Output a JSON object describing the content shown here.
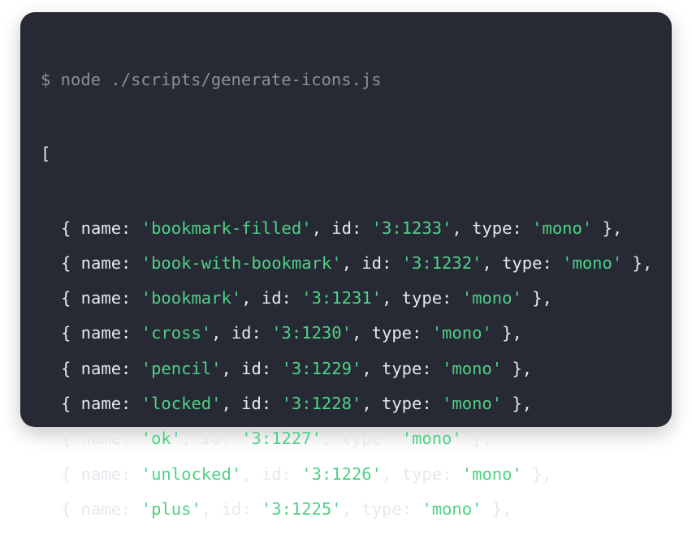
{
  "terminal": {
    "command": "$ node ./scripts/generate-icons.js",
    "open_bracket": "[",
    "entries": [
      {
        "name": "bookmark-filled",
        "id": "3:1233",
        "type": "mono"
      },
      {
        "name": "book-with-bookmark",
        "id": "3:1232",
        "type": "mono"
      },
      {
        "name": "bookmark",
        "id": "3:1231",
        "type": "mono"
      },
      {
        "name": "cross",
        "id": "3:1230",
        "type": "mono"
      },
      {
        "name": "pencil",
        "id": "3:1229",
        "type": "mono"
      },
      {
        "name": "locked",
        "id": "3:1228",
        "type": "mono"
      },
      {
        "name": "ok",
        "id": "3:1227",
        "type": "mono"
      },
      {
        "name": "unlocked",
        "id": "3:1226",
        "type": "mono"
      },
      {
        "name": "plus",
        "id": "3:1225",
        "type": "mono"
      }
    ],
    "colors": {
      "background": "#272a34",
      "prompt": "#8b8f99",
      "text": "#e6e8ee",
      "string": "#4fd187"
    }
  }
}
